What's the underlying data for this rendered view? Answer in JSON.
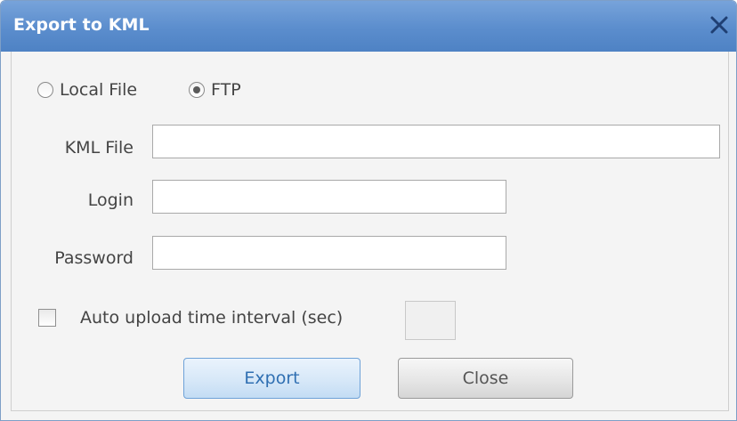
{
  "dialog": {
    "title": "Export to KML",
    "close_icon": "close-icon"
  },
  "destination": {
    "options": [
      "Local File",
      "FTP"
    ],
    "selected": "FTP"
  },
  "fields": {
    "kml_file_label": "KML File",
    "kml_file_value": "",
    "login_label": "Login",
    "login_value": "",
    "password_label": "Password",
    "password_value": ""
  },
  "auto_upload": {
    "label": "Auto upload time interval (sec)",
    "checked": false,
    "interval_value": ""
  },
  "buttons": {
    "export_label": "Export",
    "close_label": "Close"
  },
  "colors": {
    "titlebar": "#5b8dcd",
    "accent": "#2f6fb2"
  }
}
